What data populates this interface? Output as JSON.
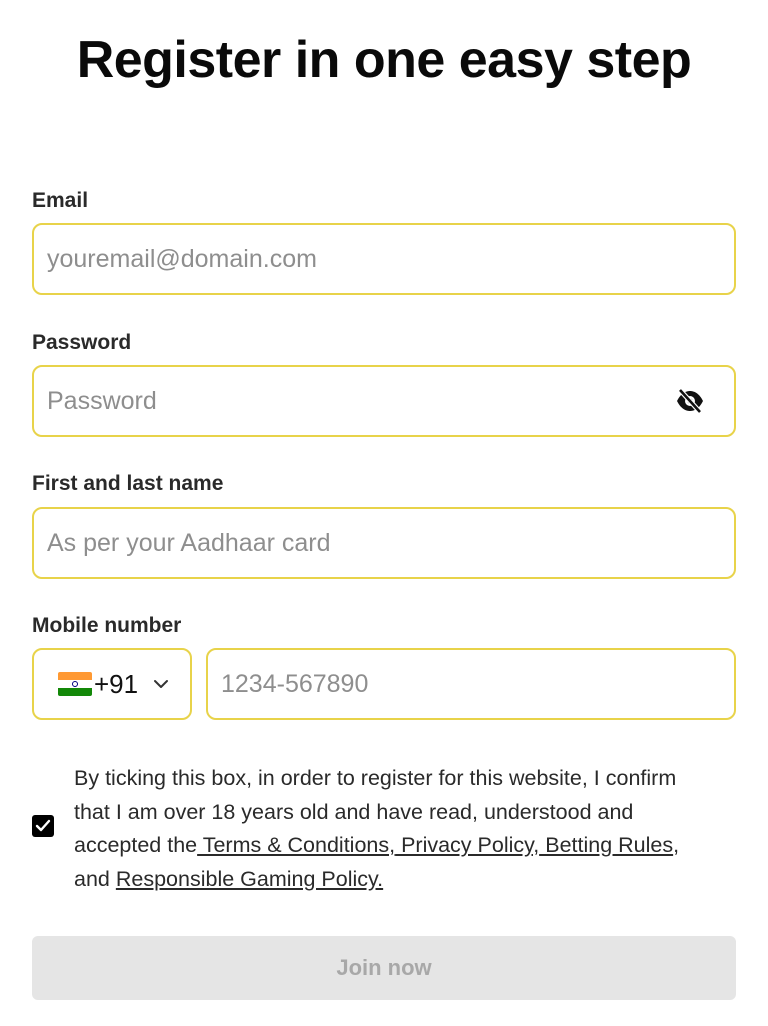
{
  "title": "Register in one easy step",
  "email": {
    "label": "Email",
    "placeholder": "youremail@domain.com"
  },
  "password": {
    "label": "Password",
    "placeholder": "Password",
    "toggle_icon": "eye-slash-icon"
  },
  "name": {
    "label": "First and last name",
    "placeholder": "As per your Aadhaar card"
  },
  "mobile": {
    "label": "Mobile number",
    "country_flag": "india-flag-icon",
    "dial_code": "+91",
    "placeholder": "1234-567890"
  },
  "consent": {
    "checked": true,
    "text_before": "By ticking this box, in order to register for this website, I confirm that I am over 18 years old and have read, understood and accepted the",
    "link_terms": " Terms & Conditions,",
    "link_privacy": " Privacy Policy,",
    "link_betting": " Betting Rules",
    "text_and": ", and ",
    "link_responsible": "Responsible Gaming Policy."
  },
  "submit": {
    "label": "Join now",
    "disabled": true
  },
  "colors": {
    "field_border": "#e8d34a",
    "button_disabled_bg": "#e5e5e5",
    "button_disabled_text": "#a8a8a8"
  }
}
